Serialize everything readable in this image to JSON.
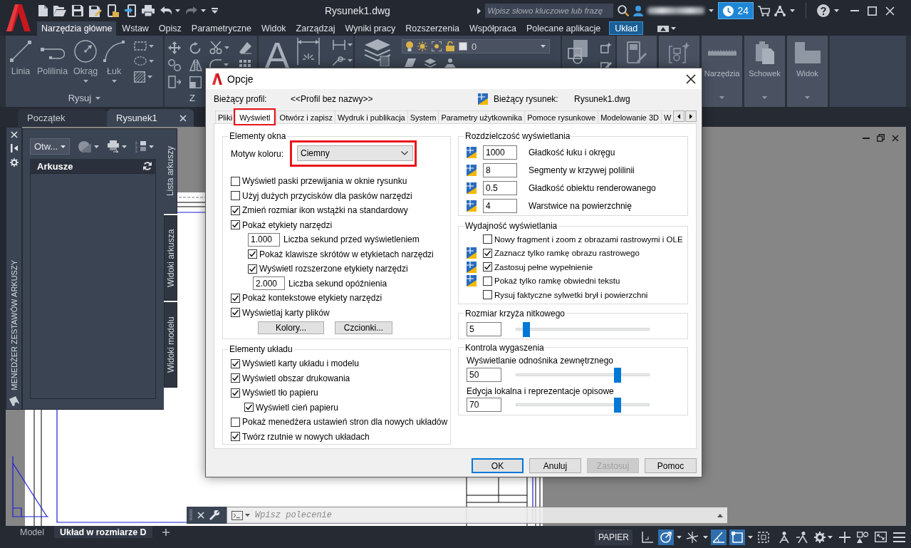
{
  "title_bar": {
    "title": "Rysunek1.dwg",
    "search": {
      "placeholder": "Wpisz słowo kluczowe lub frazę"
    },
    "notification_count": "24"
  },
  "ribbon": {
    "tabs": [
      {
        "label": "Narzędzia główne",
        "selected": true,
        "kind": "standard"
      },
      {
        "label": "Wstaw",
        "selected": false,
        "kind": "standard"
      },
      {
        "label": "Opisz",
        "selected": false,
        "kind": "standard"
      },
      {
        "label": "Parametryczne",
        "selected": false,
        "kind": "standard"
      },
      {
        "label": "Widok",
        "selected": false,
        "kind": "standard"
      },
      {
        "label": "Zarządzaj",
        "selected": false,
        "kind": "standard"
      },
      {
        "label": "Wyniki pracy",
        "selected": false,
        "kind": "standard"
      },
      {
        "label": "Rozszerzenia",
        "selected": false,
        "kind": "standard"
      },
      {
        "label": "Współpraca",
        "selected": false,
        "kind": "standard"
      },
      {
        "label": "Polecane aplikacje",
        "selected": false,
        "kind": "standard"
      },
      {
        "label": "Układ",
        "selected": false,
        "kind": "contextual"
      }
    ],
    "draw_panel": {
      "title": "Rysuj",
      "tools": [
        {
          "label": "Linia",
          "kind": "line",
          "dropdown": false
        },
        {
          "label": "Polilinia",
          "kind": "polyline",
          "dropdown": false
        },
        {
          "label": "Okrąg",
          "kind": "circle",
          "dropdown": true
        },
        {
          "label": "Łuk",
          "kind": "arc",
          "dropdown": true
        }
      ]
    },
    "modify_panel": {
      "title": "Z"
    },
    "annotation_panel": {
      "text_tool": "A"
    },
    "layers_panel": {
      "current_layer": "0"
    },
    "collapsed_panels": [
      {
        "kind": "properties"
      },
      {
        "kind": "groups"
      },
      {
        "kind": "utilities",
        "label": "Narzędzia"
      },
      {
        "kind": "clipboard",
        "label": "Schowek"
      },
      {
        "kind": "view",
        "label": "Widok"
      }
    ]
  },
  "file_tabs": [
    {
      "label": "Początek",
      "selected": false,
      "closable": false
    },
    {
      "label": "Rysunek1",
      "selected": true,
      "closable": true
    }
  ],
  "sheet_set_manager": {
    "title": "MENEDŻER ZESTAWÓW ARKUSZY",
    "open_dropdown": "Otw...",
    "list_header": "Arkusze",
    "side_tabs": [
      {
        "label": "Lista arkuszy",
        "selected": true
      },
      {
        "label": "Widoki arkusza",
        "selected": false
      },
      {
        "label": "Widoki modelu",
        "selected": false
      }
    ]
  },
  "options_dialog": {
    "title": "Opcje",
    "profile": {
      "label": "Bieżący profil:",
      "value": "<<Profil bez nazwy>>"
    },
    "drawing": {
      "label": "Bieżący rysunek:",
      "value": "Rysunek1.dwg"
    },
    "tabs": [
      {
        "label": "Pliki",
        "selected": false,
        "highlighted": false
      },
      {
        "label": "Wyświetl",
        "selected": true,
        "highlighted": true
      },
      {
        "label": "Otwórz i zapisz",
        "selected": false,
        "highlighted": false
      },
      {
        "label": "Wydruk i publikacja",
        "selected": false,
        "highlighted": false
      },
      {
        "label": "System",
        "selected": false,
        "highlighted": false
      },
      {
        "label": "Parametry użytkownika",
        "selected": false,
        "highlighted": false
      },
      {
        "label": "Pomoce rysunkowe",
        "selected": false,
        "highlighted": false
      },
      {
        "label": "Modelowanie 3D",
        "selected": false,
        "highlighted": false
      },
      {
        "label": "W",
        "selected": false,
        "highlighted": false
      }
    ],
    "window_elements": {
      "title": "Elementy okna",
      "color_theme": {
        "label": "Motyw koloru:",
        "value": "Ciemny",
        "highlighted": true
      },
      "options": [
        {
          "kind": "checkbox",
          "label": "Wyświetl paski przewijania w oknie rysunku",
          "checked": false
        },
        {
          "kind": "checkbox",
          "label": "Użyj dużych przycisków dla pasków narzędzi",
          "checked": false
        },
        {
          "kind": "checkbox",
          "label": "Zmień rozmiar ikon wstążki na standardowy",
          "checked": true
        },
        {
          "kind": "checkbox",
          "label": "Pokaż etykiety narzędzi",
          "checked": true,
          "children": [
            {
              "kind": "number",
              "value": "1.000",
              "label": "Liczba sekund przed wyświetleniem"
            },
            {
              "kind": "checkbox",
              "label": "Pokaż klawisze skrótów w etykietach narzędzi",
              "checked": true
            },
            {
              "kind": "checkbox",
              "label": "Wyświetl rozszerzone etykiety narzędzi",
              "checked": true,
              "children": [
                {
                  "kind": "number",
                  "value": "2.000",
                  "label": "Liczba sekund opóźnienia"
                }
              ]
            }
          ]
        },
        {
          "kind": "checkbox",
          "label": "Pokaż kontekstowe etykiety narzędzi",
          "checked": true
        },
        {
          "kind": "checkbox",
          "label": "Wyświetlaj karty plików",
          "checked": true
        }
      ],
      "buttons": [
        "Kolory...",
        "Czcionki..."
      ]
    },
    "layout_elements": {
      "title": "Elementy układu",
      "options": [
        {
          "kind": "checkbox",
          "label": "Wyświetl karty układu i modelu",
          "checked": true
        },
        {
          "kind": "checkbox",
          "label": "Wyświetl obszar drukowania",
          "checked": true
        },
        {
          "kind": "checkbox",
          "label": "Wyświetl tło papieru",
          "checked": true,
          "children": [
            {
              "kind": "checkbox",
              "label": "Wyświetl cień papieru",
              "checked": true
            }
          ]
        },
        {
          "kind": "checkbox",
          "label": "Pokaż menedżera ustawień stron dla nowych układów",
          "checked": false
        },
        {
          "kind": "checkbox",
          "label": "Twórz rzutnie w nowych układach",
          "checked": true
        }
      ]
    },
    "display_resolution": {
      "title": "Rozdzielczość wyświetlania",
      "items": [
        {
          "value": "1000",
          "label": "Gładkość łuku i okręgu",
          "saved_in_drawing": true
        },
        {
          "value": "8",
          "label": "Segmenty w krzywej polilinii",
          "saved_in_drawing": true
        },
        {
          "value": "0.5",
          "label": "Gładkość obiektu renderowanego",
          "saved_in_drawing": true
        },
        {
          "value": "4",
          "label": "Warstwice na powierzchnię",
          "saved_in_drawing": true
        }
      ]
    },
    "display_performance": {
      "title": "Wydajność wyświetlania",
      "items": [
        {
          "label": "Nowy fragment i zoom z obrazami rastrowymi i OLE",
          "checked": false,
          "saved_in_drawing": false
        },
        {
          "label": "Zaznacz tylko ramkę obrazu rastrowego",
          "checked": true,
          "saved_in_drawing": true
        },
        {
          "label": "Zastosuj pełne wypełnienie",
          "checked": true,
          "saved_in_drawing": true
        },
        {
          "label": "Pokaż tylko ramkę obwiedni tekstu",
          "checked": false,
          "saved_in_drawing": true
        },
        {
          "label": "Rysuj faktyczne sylwetki brył i powierzchni",
          "checked": false,
          "saved_in_drawing": false
        }
      ]
    },
    "crosshair_size": {
      "title": "Rozmiar krzyża nitkowego",
      "value": "5",
      "level": 0.05
    },
    "fade_control": {
      "title": "Kontrola wygaszenia",
      "items": [
        {
          "label": "Wyświetlanie odnośnika zewnętrznego",
          "value": "50",
          "level": 0.78
        },
        {
          "label": "Edycja lokalna i reprezentacje opisowe",
          "value": "70",
          "level": 0.78
        }
      ]
    },
    "buttons": [
      {
        "label": "OK",
        "default": true,
        "disabled": false
      },
      {
        "label": "Anuluj",
        "default": false,
        "disabled": false
      },
      {
        "label": "Zastosuj",
        "default": false,
        "disabled": true
      },
      {
        "label": "Pomoc",
        "default": false,
        "disabled": false
      }
    ]
  },
  "command_line": {
    "placeholder": "Wpisz polecenie"
  },
  "status_bar": {
    "layout_tabs": [
      {
        "label": "Model",
        "selected": false
      },
      {
        "label": "Układ w rozmiarze D",
        "selected": true
      }
    ],
    "space_button": "PAPIER",
    "toggles": [
      {
        "kind": "corner",
        "on": false,
        "dropdown": false
      },
      {
        "kind": "polar",
        "on": true,
        "dropdown": true
      },
      {
        "kind": "lines",
        "on": false,
        "dropdown": true
      },
      {
        "kind": "angle",
        "on": true,
        "dropdown": false
      },
      {
        "kind": "square",
        "on": true,
        "dropdown": true
      },
      {
        "kind": "dashed",
        "on": false,
        "dropdown": false
      }
    ]
  }
}
